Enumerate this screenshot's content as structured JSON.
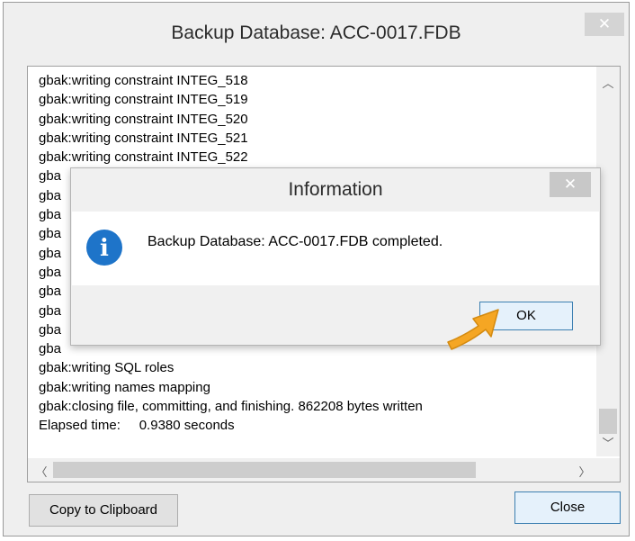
{
  "main_window": {
    "title": "Backup Database: ACC-0017.FDB",
    "close_glyph": "✕",
    "log_lines": [
      "gbak:writing constraint INTEG_518",
      "gbak:writing constraint INTEG_519",
      "gbak:writing constraint INTEG_520",
      "gbak:writing constraint INTEG_521",
      "gbak:writing constraint INTEG_522",
      "gba",
      "gba",
      "gba",
      "gba",
      "gba",
      "gba",
      "gba",
      "gba",
      "gba",
      "gba",
      "gbak:writing SQL roles",
      "gbak:writing names mapping",
      "gbak:closing file, committing, and finishing. 862208 bytes written",
      "Elapsed time:     0.9380 seconds"
    ],
    "copy_button": "Copy to Clipboard",
    "close_button": "Close"
  },
  "info_dialog": {
    "title": "Information",
    "close_glyph": "✕",
    "message": "Backup Database: ACC-0017.FDB completed.",
    "ok_button": "OK",
    "icon": "info-icon"
  },
  "colors": {
    "info_icon": "#1e74c9",
    "pointer": "#f5a623",
    "primary_border": "#3c7fb1"
  }
}
